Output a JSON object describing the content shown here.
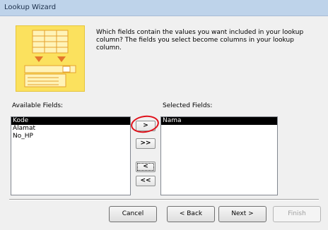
{
  "window": {
    "title": "Lookup Wizard"
  },
  "description": "Which fields contain the values you want included in your lookup column? The fields you select become columns in your lookup column.",
  "available": {
    "label": "Available Fields:",
    "items": [
      "Kode",
      "Alamat",
      "No_HP"
    ]
  },
  "selected": {
    "label": "Selected Fields:",
    "items": [
      "Nama"
    ]
  },
  "move_buttons": {
    "add_one": ">",
    "add_all": ">>",
    "remove_one": "<",
    "remove_all": "<<"
  },
  "footer": {
    "cancel": "Cancel",
    "back": "< Back",
    "next": "Next >",
    "finish": "Finish"
  },
  "colors": {
    "annotation": "#e0101a",
    "illustration": "#fbe15e"
  }
}
